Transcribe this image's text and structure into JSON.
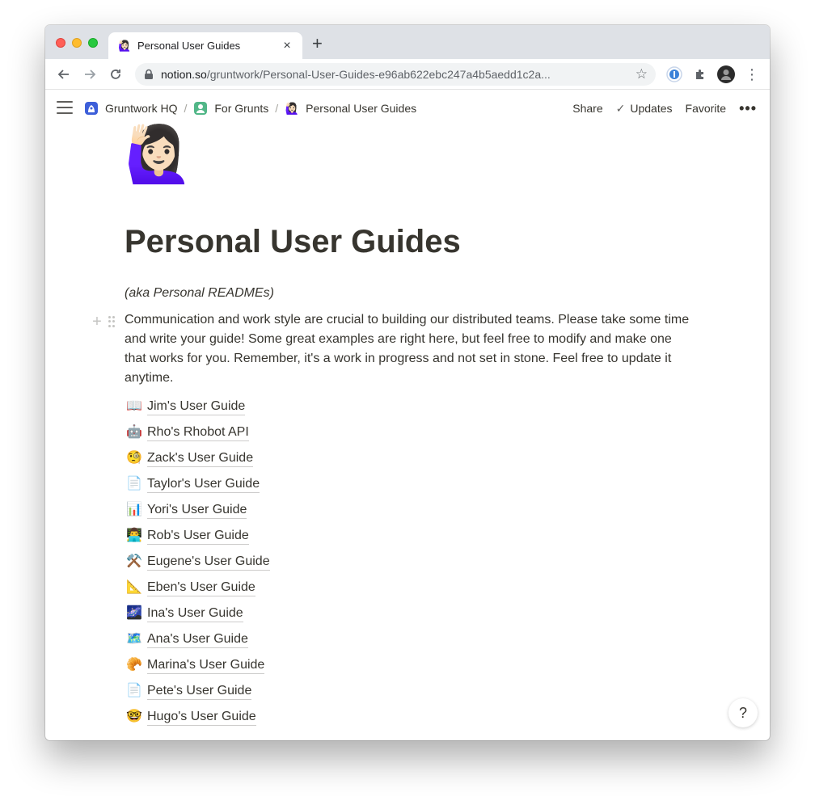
{
  "browser": {
    "tab": {
      "title": "Personal User Guides",
      "favicon": "🙋🏻‍♀️",
      "close": "×"
    },
    "new_tab": "+",
    "url_domain": "notion.so",
    "url_path": "/gruntwork/Personal-User-Guides-e96ab622ebc247a4b5aedd1c2a...",
    "icons": {
      "back": "←",
      "forward": "→",
      "reload": "↻",
      "star": "☆",
      "more": "⋮"
    }
  },
  "topbar": {
    "breadcrumbs": [
      {
        "label": "Gruntwork HQ",
        "icon": "logo-icon"
      },
      {
        "label": "For Grunts",
        "icon": "logo-icon"
      },
      {
        "label": "Personal User Guides",
        "icon": "🙋🏻‍♀️"
      }
    ],
    "separator": "/",
    "actions": {
      "share": "Share",
      "updates": "Updates",
      "favorite": "Favorite",
      "more": "•••"
    }
  },
  "page": {
    "icon": "🙋🏻‍♀️",
    "title": "Personal User Guides",
    "subtitle": "(aka Personal READMEs)",
    "intro": "Communication and work style are crucial to building our distributed teams. Please take some time and write your guide! Some great examples are right here, but feel free to modify and make one that works for you. Remember, it's a work in progress and not set in stone. Feel free to update it anytime.",
    "handle_plus": "+",
    "guides": [
      {
        "icon": "📖",
        "label": "Jim's User Guide"
      },
      {
        "icon": "🤖",
        "label": "Rho's Rhobot API"
      },
      {
        "icon": "🧐",
        "label": "Zack's User Guide"
      },
      {
        "icon": "📄",
        "label": "Taylor's User Guide"
      },
      {
        "icon": "📊",
        "label": "Yori's User Guide"
      },
      {
        "icon": "👨‍💻",
        "label": "Rob's User Guide"
      },
      {
        "icon": "⚒️",
        "label": "Eugene's User Guide"
      },
      {
        "icon": "📐",
        "label": "Eben's User Guide"
      },
      {
        "icon": "🌌",
        "label": "Ina's User Guide"
      },
      {
        "icon": "🗺️",
        "label": "Ana's User Guide"
      },
      {
        "icon": "🥐",
        "label": "Marina's User Guide"
      },
      {
        "icon": "📄",
        "label": "Pete's User Guide"
      },
      {
        "icon": "🤓",
        "label": "Hugo's User Guide"
      }
    ],
    "help": "?"
  }
}
